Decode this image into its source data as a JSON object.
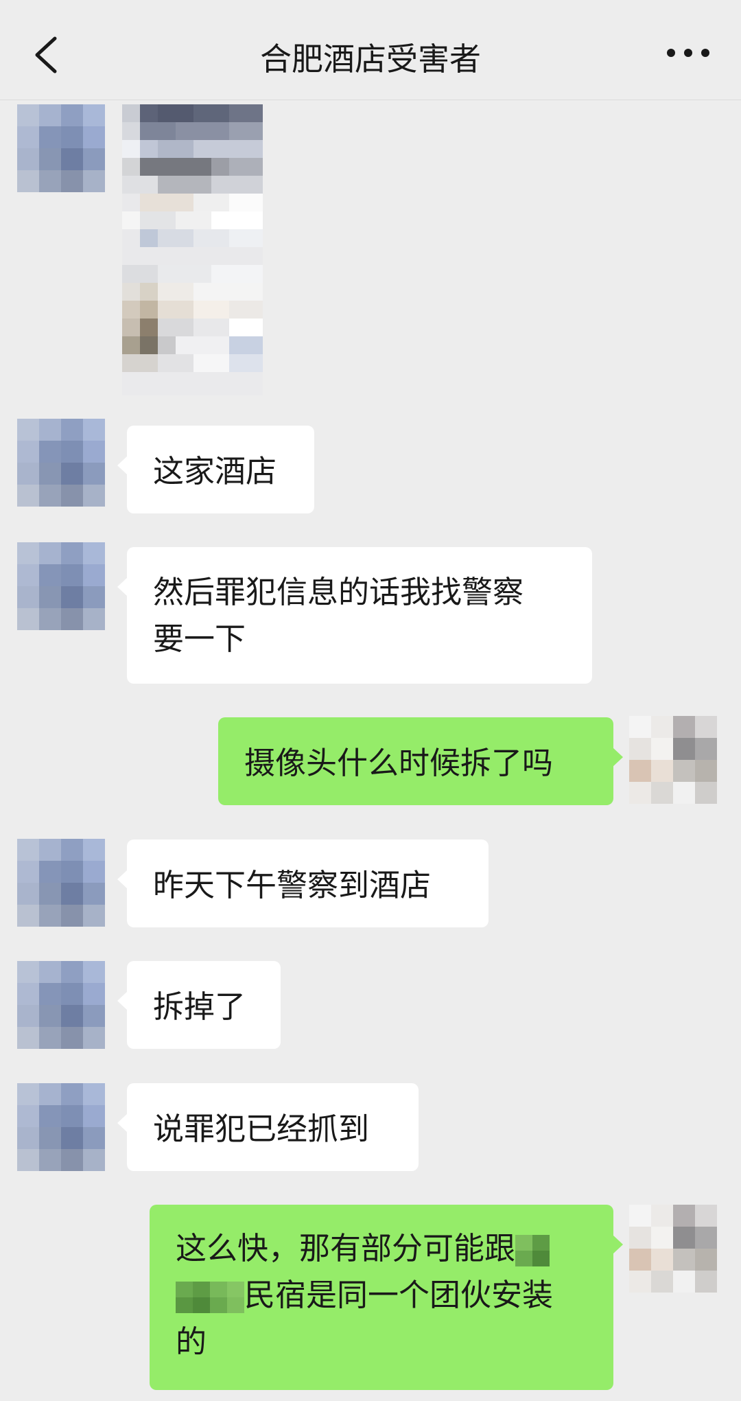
{
  "header": {
    "title": "合肥酒店受害者"
  },
  "messages": [
    {
      "side": "in",
      "type": "image"
    },
    {
      "side": "in",
      "text": "这家酒店"
    },
    {
      "side": "in",
      "line1": "然后罪犯信息的话我找警察",
      "line2": "要一下"
    },
    {
      "side": "out",
      "text": "摄像头什么时候拆了吗"
    },
    {
      "side": "in",
      "text": "昨天下午警察到酒店"
    },
    {
      "side": "in",
      "text": "拆掉了"
    },
    {
      "side": "in",
      "text": "说罪犯已经抓到"
    },
    {
      "side": "out",
      "line1": "这么快，那有部分可能跟",
      "line2": "民宿是同一个团伙安装",
      "line3": "的"
    }
  ],
  "colors": {
    "background": "#ededed",
    "incoming": "#ffffff",
    "outgoing": "#95ec69"
  }
}
